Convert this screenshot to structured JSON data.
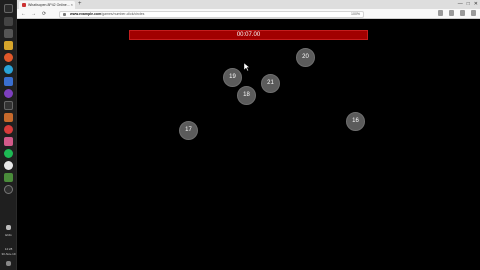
{
  "browser": {
    "tab_title": "Whatisopen.8P42 Online...",
    "tab_close": "×",
    "new_tab": "+",
    "url_domain": "www.example.com",
    "url_path": "/games/number-click/circles",
    "url_extra": "100%",
    "nav": {
      "back": "←",
      "forward": "→",
      "reload": "⟳"
    },
    "window_controls": [
      "—",
      "□",
      "✕"
    ]
  },
  "taskbar": {
    "time": "14:28",
    "date": "30-Nov-19",
    "lang": "ENG"
  },
  "game": {
    "timer": "00:07.00",
    "circles": [
      {
        "label": "20"
      },
      {
        "label": "19"
      },
      {
        "label": "21"
      },
      {
        "label": "18"
      },
      {
        "label": "17"
      },
      {
        "label": "16"
      }
    ]
  },
  "colors": {
    "timer_bg": "#a10000",
    "circle_fill": "#5b5b5b",
    "background": "#000000"
  }
}
